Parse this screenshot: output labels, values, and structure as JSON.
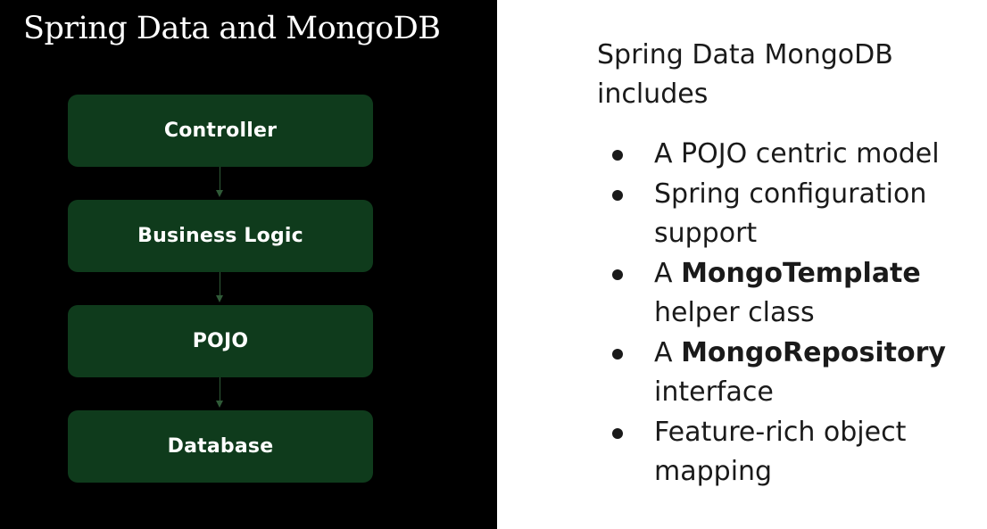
{
  "slide": {
    "title": "Spring Data and MongoDB"
  },
  "diagram": {
    "box_color": "#0f3b1c",
    "connector_color": "#2f5a37",
    "layers": [
      {
        "label": "Controller"
      },
      {
        "label": "Business Logic"
      },
      {
        "label": "POJO"
      },
      {
        "label": "Database"
      }
    ]
  },
  "content": {
    "intro_line1": "Spring Data MongoDB",
    "intro_line2": "includes",
    "features": [
      {
        "line1_prefix": "A POJO centric model",
        "line1_bold": "",
        "line2": ""
      },
      {
        "line1_prefix": "Spring configuration",
        "line1_bold": "",
        "line2": "support"
      },
      {
        "line1_prefix": "A ",
        "line1_bold": "MongoTemplate",
        "line2": "helper class"
      },
      {
        "line1_prefix": "A ",
        "line1_bold": "MongoRepository",
        "line2": "interface"
      },
      {
        "line1_prefix": "Feature-rich object",
        "line1_bold": "",
        "line2": "mapping"
      }
    ]
  }
}
